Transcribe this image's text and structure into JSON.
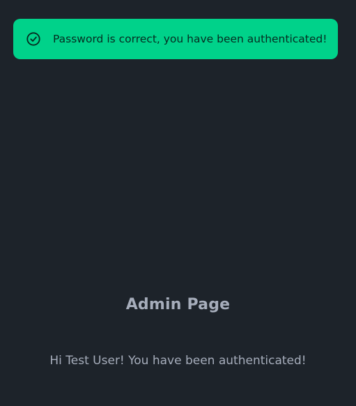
{
  "toast": {
    "icon": "check-circle-icon",
    "message": "Password is correct, you have been authenticated!",
    "background_color": "#00d28a"
  },
  "main": {
    "title": "Admin Page",
    "greeting": "Hi Test User! You have been authenticated!"
  },
  "colors": {
    "page_background": "#1d232a",
    "text": "#a6adbb"
  }
}
